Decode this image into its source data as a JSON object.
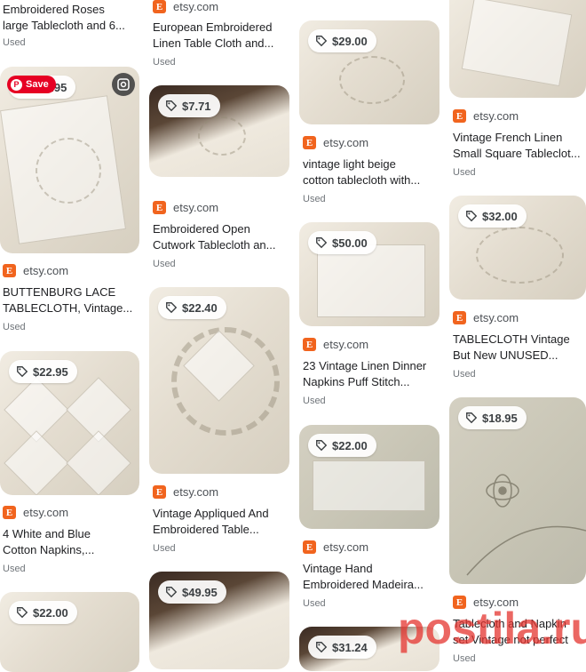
{
  "colors": {
    "etsy_brand": "#f1641e",
    "pinterest_red": "#e60023"
  },
  "overlay": {
    "save_label": "Save",
    "watermark_text": "postila.ru"
  },
  "cards": {
    "c1": {
      "source": "",
      "title1": "Embroidered Roses",
      "title2": "large Tablecloth and 6...",
      "cond": "Used"
    },
    "c2": {
      "price": "…4.95",
      "source": "etsy.com",
      "title1": "BUTTENBURG LACE",
      "title2": "TABLECLOTH, Vintage...",
      "cond": "Used"
    },
    "c3": {
      "price": "$22.95",
      "source": "etsy.com",
      "title1": "4 White and Blue",
      "title2": "Cotton Napkins,...",
      "cond": "Used"
    },
    "c4": {
      "price": "$22.00"
    },
    "c5": {
      "source": "etsy.com",
      "title1": "European Embroidered",
      "title2": "Linen Table Cloth and...",
      "cond": "Used"
    },
    "c6": {
      "price": "$7.71",
      "source": "etsy.com",
      "title1": "Embroidered Open",
      "title2": "Cutwork Tablecloth an...",
      "cond": "Used"
    },
    "c7": {
      "price": "$22.40",
      "source": "etsy.com",
      "title1": "Vintage Appliqued And",
      "title2": "Embroidered Table...",
      "cond": "Used"
    },
    "c8": {
      "price": "$49.95"
    },
    "c9": {
      "price": "$29.00",
      "source": "etsy.com",
      "title1": "vintage light beige",
      "title2": "cotton tablecloth with...",
      "cond": "Used"
    },
    "c10": {
      "price": "$50.00",
      "source": "etsy.com",
      "title1": "23 Vintage Linen Dinner",
      "title2": "Napkins Puff Stitch...",
      "cond": "Used"
    },
    "c11": {
      "price": "$22.00",
      "source": "etsy.com",
      "title1": "Vintage Hand",
      "title2": "Embroidered Madeira...",
      "cond": "Used"
    },
    "c12": {
      "price": "$31.24"
    },
    "c13": {
      "source": "etsy.com",
      "title1": "Vintage French Linen",
      "title2": "Small Square Tableclot...",
      "cond": "Used"
    },
    "c14": {
      "price": "$32.00",
      "source": "etsy.com",
      "title1": "TABLECLOTH Vintage",
      "title2": "But New UNUSED...",
      "cond": "Used"
    },
    "c15": {
      "price": "$18.95",
      "source": "etsy.com",
      "title1": "Tablecloth and Napkin",
      "title2": "set Vintage not perfect",
      "cond": "Used"
    }
  }
}
